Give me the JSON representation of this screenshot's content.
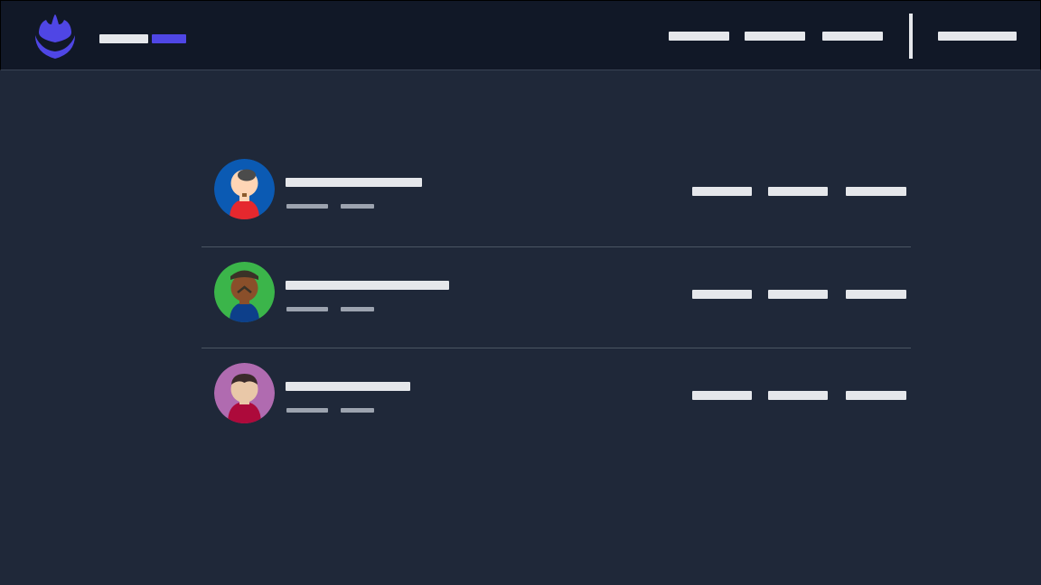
{
  "colors": {
    "page_bg": "#1f2839",
    "header_bg": "#111827",
    "accent": "#4f46e5",
    "text_bar": "#e5e7eb",
    "meta_bar": "#9ca3af",
    "divider": "#4b5563"
  },
  "header": {
    "logo_icon": "shield-crown-logo",
    "nav": [
      {
        "label": ""
      },
      {
        "label": ""
      },
      {
        "label": ""
      },
      {
        "label": ""
      }
    ]
  },
  "people": [
    {
      "avatar_bg": "#0b5ab3",
      "shirt": "#e5282e",
      "skin": "#ffd5b5",
      "hair": "#4b4b4b",
      "name": "",
      "meta": [
        "",
        ""
      ],
      "actions": [
        "",
        "",
        ""
      ]
    },
    {
      "avatar_bg": "#3bb54a",
      "shirt": "#0d3f8a",
      "skin": "#8a4f2a",
      "hair": "#3a3227",
      "name": "",
      "meta": [
        "",
        ""
      ],
      "actions": [
        "",
        "",
        ""
      ]
    },
    {
      "avatar_bg": "#b06bb0",
      "shirt": "#ad0a3b",
      "skin": "#e9c8a8",
      "hair": "#3a2a2a",
      "name": "",
      "meta": [
        "",
        ""
      ],
      "actions": [
        "",
        "",
        ""
      ]
    }
  ]
}
